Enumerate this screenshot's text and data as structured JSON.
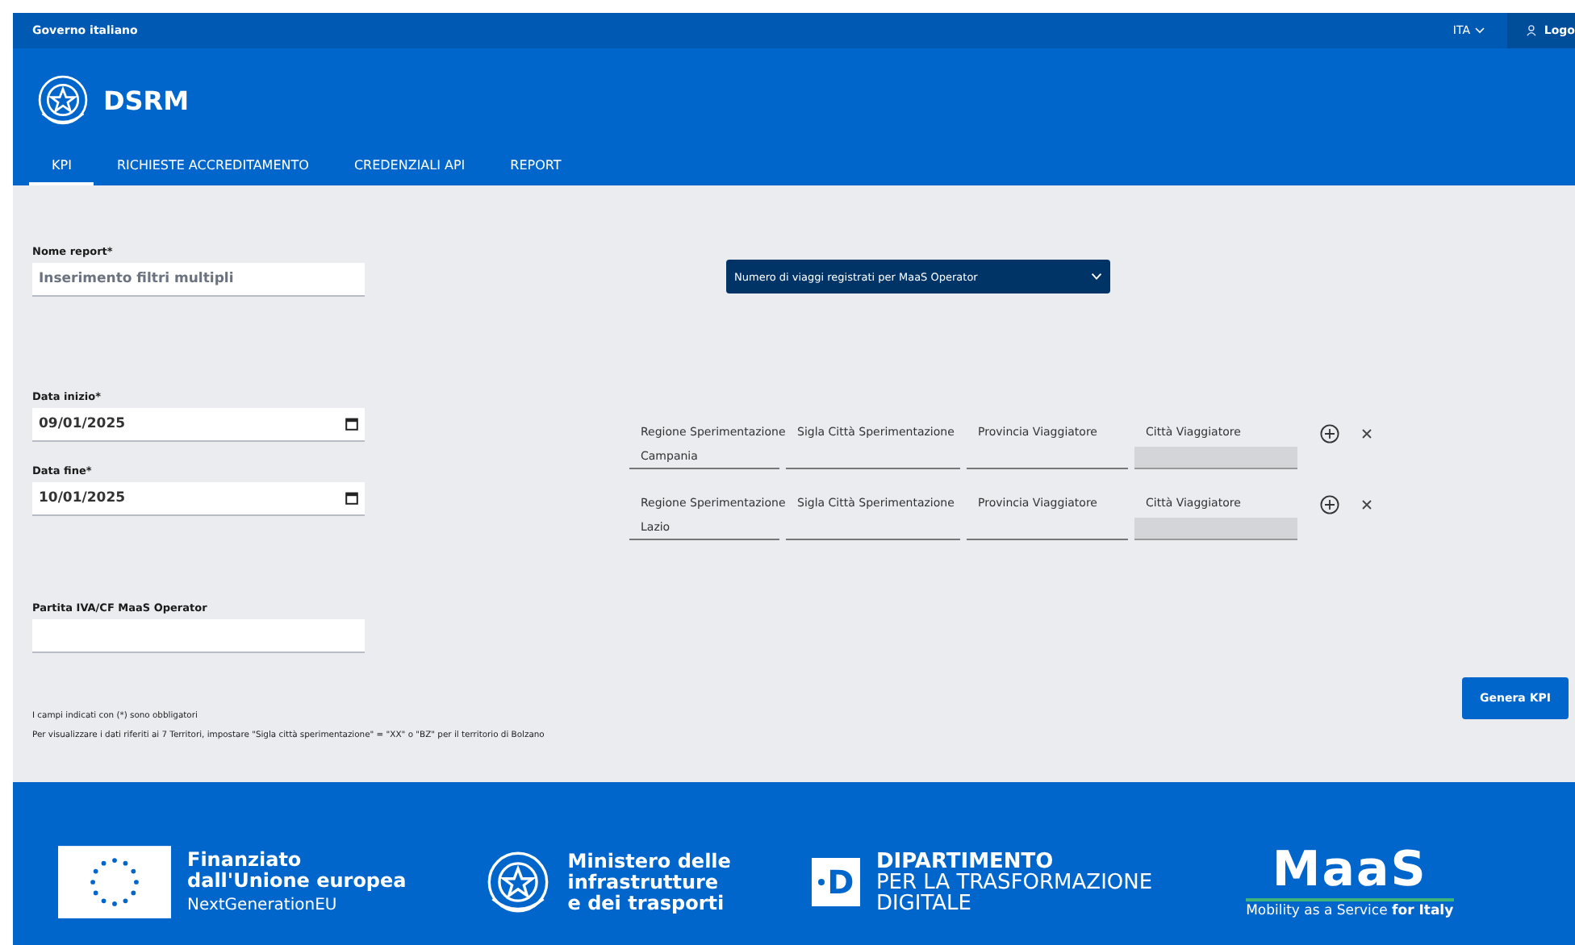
{
  "top_bar": {
    "org": "Governo italiano",
    "language": "ITA",
    "login": "Logo"
  },
  "header": {
    "title": "DSRM"
  },
  "tabs": [
    {
      "label": "KPI",
      "selected": true
    },
    {
      "label": "RICHIESTE ACCREDITAMENTO",
      "selected": false
    },
    {
      "label": "CREDENZIALI API",
      "selected": false
    },
    {
      "label": "REPORT",
      "selected": false
    }
  ],
  "form": {
    "fields": [
      {
        "label": "Nome report*",
        "kind": "text",
        "placeholder": "Inserimento filtri multipli"
      },
      {
        "label": "Data inizio*",
        "kind": "date",
        "value": "09/01/2025"
      },
      {
        "label": "Data fine*",
        "kind": "date",
        "value": "10/01/2025"
      },
      {
        "label": "Partita IVA/CF MaaS Operator",
        "kind": "text"
      }
    ],
    "kpi_select": "Numero di viaggi registrati per MaaS Operator",
    "filters": [
      {
        "fields": [
          {
            "label": "Regione Sperimentazione",
            "value": "Campania",
            "disabled": false
          },
          {
            "label": "Sigla Città Sperimentazione",
            "disabled": false
          },
          {
            "label": "Provincia Viaggiatore",
            "disabled": false
          },
          {
            "label": "Città Viaggiatore",
            "disabled": true
          }
        ]
      },
      {
        "fields": [
          {
            "label": "Regione Sperimentazione",
            "value": "Lazio",
            "disabled": false
          },
          {
            "label": "Sigla Città Sperimentazione",
            "disabled": false
          },
          {
            "label": "Provincia Viaggiatore",
            "disabled": false
          },
          {
            "label": "Città Viaggiatore",
            "disabled": true
          }
        ]
      }
    ],
    "submit": "Genera KPI",
    "notes": [
      "I campi indicati con (*) sono obbligatori",
      "Per visualizzare i dati riferiti ai 7 Territori, impostare \"Sigla città sperimentazione\" = \"XX\" o \"BZ\" per il territorio di Bolzano"
    ]
  },
  "footer": {
    "logos": [
      {
        "kind": "eu",
        "lines": [
          "Finanziato",
          "dall'Unione europea",
          "NextGenerationEU"
        ]
      },
      {
        "kind": "ministry",
        "lines": [
          "Ministero delle",
          "infrastrutture",
          "e dei trasporti"
        ]
      },
      {
        "kind": "department",
        "mark": "D",
        "lines": [
          "DIPARTIMENTO",
          "PER LA TRASFORMAZIONE",
          "DIGITALE"
        ]
      },
      {
        "kind": "maas",
        "mark": "MaaS",
        "lines": [
          "Mobility as a Service **for Italy**"
        ]
      }
    ]
  }
}
